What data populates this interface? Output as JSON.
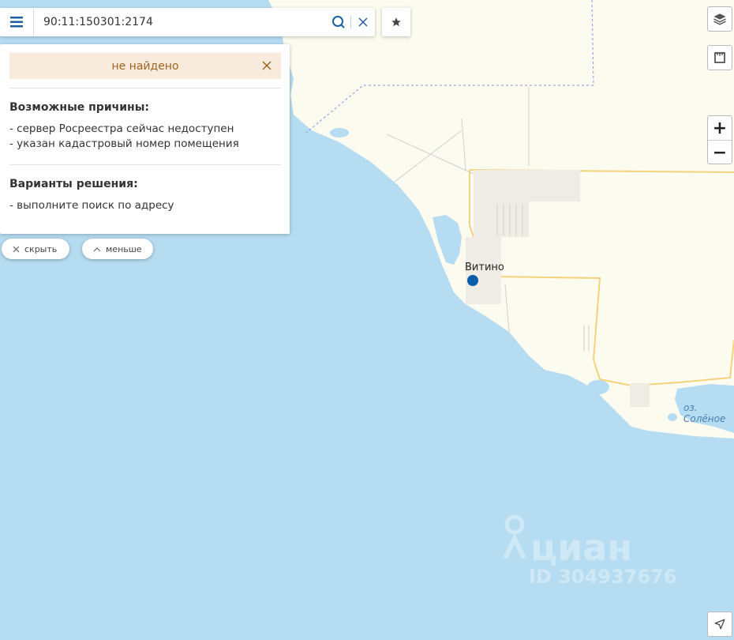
{
  "search": {
    "value": "90:11:150301:2174"
  },
  "result_panel": {
    "status": "не найдено",
    "reasons_title": "Возможные причины:",
    "reasons": [
      "- сервер Росреестра сейчас недоступен",
      "- указан кадастровый номер помещения"
    ],
    "solutions_title": "Варианты решения:",
    "solutions": [
      "- выполните поиск по адресу"
    ]
  },
  "controls": {
    "hide_label": "скрыть",
    "less_label": "меньше",
    "zoom_in": "+",
    "zoom_out": "−"
  },
  "map": {
    "place_name": "Витино",
    "lake_name": "оз. Солёное"
  },
  "watermark": {
    "brand": "циан",
    "id": "ID 304937676"
  },
  "colors": {
    "accent": "#1d5fa0",
    "sea": "#b6dcf2",
    "land": "#fcfbef",
    "road": "#f3d27a",
    "marker": "#0b5ca8"
  }
}
